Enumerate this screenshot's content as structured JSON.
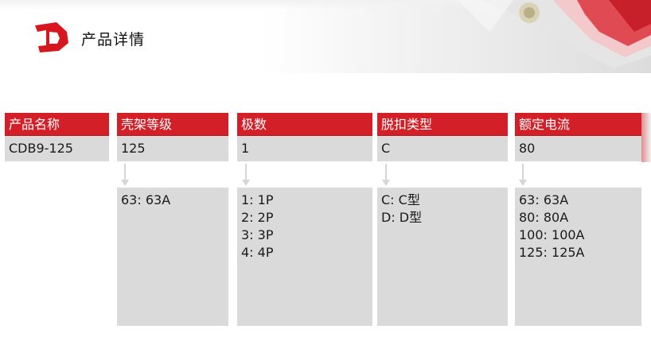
{
  "header": {
    "title": "产品详情"
  },
  "columns": [
    {
      "header": "产品名称",
      "value": "CDB9-125",
      "options": []
    },
    {
      "header": "壳架等级",
      "value": "125",
      "options": [
        "63: 63A"
      ]
    },
    {
      "header": "极数",
      "value": "1",
      "options": [
        "1: 1P",
        "2: 2P",
        "3: 3P",
        "4: 4P"
      ]
    },
    {
      "header": "脱扣类型",
      "value": "C",
      "options": [
        "C: C型",
        "D: D型"
      ]
    },
    {
      "header": "额定电流",
      "value": "80",
      "options": [
        "63: 63A",
        "80: 80A",
        "100: 100A",
        "125: 125A"
      ]
    }
  ],
  "colors": {
    "header_red": "#d21f28",
    "cell_gray": "#dadada",
    "logo_red": "#d8161f"
  },
  "icons": [
    "brand-logo-icon",
    "down-arrow-icon"
  ]
}
